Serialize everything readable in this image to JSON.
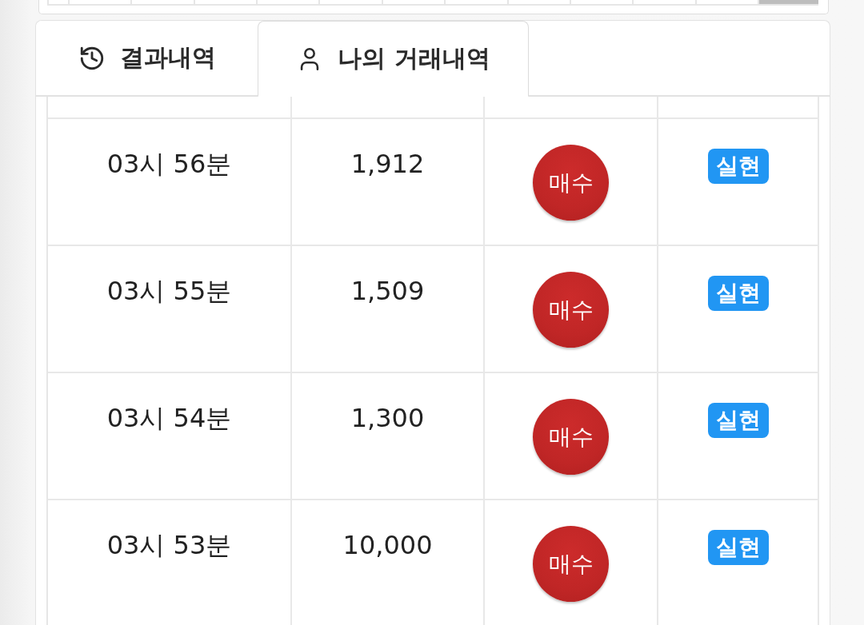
{
  "tabs": [
    {
      "label": "결과내역",
      "selected": false
    },
    {
      "label": "나의 거래내역",
      "selected": true
    }
  ],
  "table": {
    "columns": [
      {
        "kind": "text"
      },
      {
        "kind": "text"
      },
      {
        "kind": "circle"
      },
      {
        "kind": "tag"
      }
    ],
    "rows": [
      {
        "cells": [
          "03시 56분",
          "1,912",
          "매수",
          "실현"
        ]
      },
      {
        "cells": [
          "03시 55분",
          "1,509",
          "매수",
          "실현"
        ]
      },
      {
        "cells": [
          "03시 54분",
          "1,300",
          "매수",
          "실현"
        ]
      },
      {
        "cells": [
          "03시 53분",
          "10,000",
          "매수",
          "실현"
        ]
      }
    ]
  }
}
